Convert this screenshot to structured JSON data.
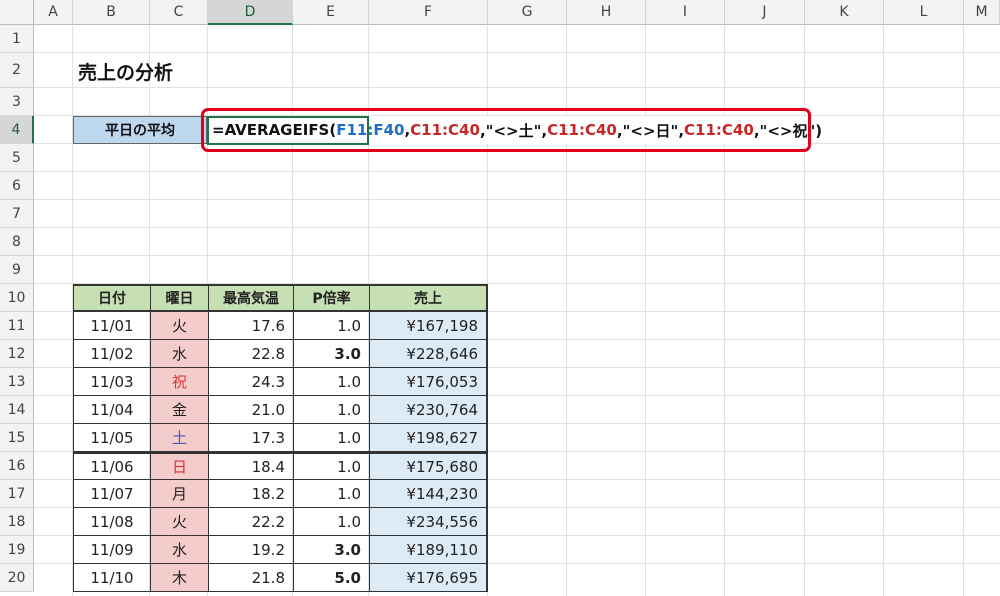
{
  "sheet": {
    "columns": [
      "A",
      "B",
      "C",
      "D",
      "E",
      "F",
      "G",
      "H",
      "I",
      "J",
      "K",
      "L",
      "M"
    ],
    "rows": [
      "1",
      "2",
      "3",
      "4",
      "5",
      "6",
      "7",
      "8",
      "9",
      "10",
      "11",
      "12",
      "13",
      "14",
      "15",
      "16",
      "17",
      "18",
      "19",
      "20"
    ],
    "selected_column": "D",
    "selected_row": "4"
  },
  "title": "売上の分析",
  "label": "平日の平均",
  "formula": {
    "p1": "=AVERAGEIFS(",
    "p2": "F11:F40",
    "p3": ",",
    "p4": "C11:C40",
    "p5": ",\"<>土\",",
    "p6": "C11:C40",
    "p7": ",\"<>日\",",
    "p8": "C11:C40",
    "p9": ",\"<>祝\")"
  },
  "table": {
    "headers": [
      "日付",
      "曜日",
      "最高気温",
      "P倍率",
      "売上"
    ],
    "rows": [
      {
        "date": "11/01",
        "day": "火",
        "temp": "17.6",
        "p": "1.0",
        "sales": "¥167,198"
      },
      {
        "date": "11/02",
        "day": "水",
        "temp": "22.8",
        "p": "3.0",
        "sales": "¥228,646"
      },
      {
        "date": "11/03",
        "day": "祝",
        "temp": "24.3",
        "p": "1.0",
        "sales": "¥176,053"
      },
      {
        "date": "11/04",
        "day": "金",
        "temp": "21.0",
        "p": "1.0",
        "sales": "¥230,764"
      },
      {
        "date": "11/05",
        "day": "土",
        "temp": "17.3",
        "p": "1.0",
        "sales": "¥198,627"
      },
      {
        "date": "11/06",
        "day": "日",
        "temp": "18.4",
        "p": "1.0",
        "sales": "¥175,680"
      },
      {
        "date": "11/07",
        "day": "月",
        "temp": "18.2",
        "p": "1.0",
        "sales": "¥144,230"
      },
      {
        "date": "11/08",
        "day": "火",
        "temp": "22.2",
        "p": "1.0",
        "sales": "¥234,556"
      },
      {
        "date": "11/09",
        "day": "水",
        "temp": "19.2",
        "p": "3.0",
        "sales": "¥189,110"
      },
      {
        "date": "11/10",
        "day": "木",
        "temp": "21.8",
        "p": "5.0",
        "sales": "¥176,695"
      }
    ]
  },
  "colors": {
    "holiday": "#e03030",
    "saturday": "#3a5fb0",
    "weekday": "#222222",
    "header_green": "#c6e0b4",
    "label_blue": "#bdd7ee",
    "highlight_red": "#e0001a",
    "selection_green": "#217346"
  }
}
